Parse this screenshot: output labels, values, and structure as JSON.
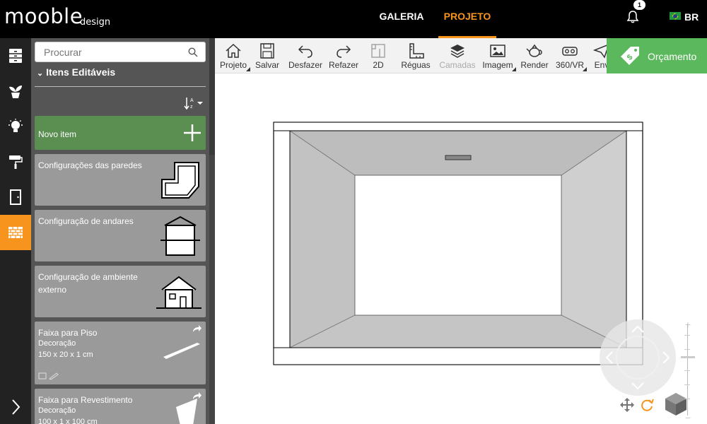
{
  "brand": {
    "name": "mooble",
    "sub": "design"
  },
  "nav": {
    "tabs": [
      "GALERIA",
      "PROJETO"
    ],
    "active": "PROJETO"
  },
  "notifications": {
    "count": "1"
  },
  "language": {
    "code": "BR"
  },
  "colors": {
    "accent": "#f7941d",
    "green": "#5a8f51",
    "orcamento": "#5cb85c"
  },
  "rail": {
    "items": [
      "furniture-icon",
      "plant-icon",
      "lamp-icon",
      "paint-roller-icon",
      "door-icon",
      "wall-brick-icon"
    ],
    "active": "wall-brick-icon"
  },
  "panel": {
    "search_placeholder": "Procurar",
    "section_title": "Itens Editáveis",
    "new_item": "Novo item",
    "cards": [
      {
        "title": "Configurações das paredes",
        "icon": "walls-config-icon"
      },
      {
        "title": "Configuração de andares",
        "icon": "floors-config-icon"
      },
      {
        "title": "Configuração de ambiente externo",
        "icon": "house-icon"
      },
      {
        "title": "Faixa para Piso",
        "category": "Decoração",
        "size": "150 x 20 x 1 cm"
      },
      {
        "title": "Faixa para Revestimento",
        "category": "Decoração",
        "size": "100 x 1 x 100 cm"
      }
    ]
  },
  "toolbar": {
    "tools": [
      {
        "label": "Projeto",
        "icon": "home-icon",
        "submenu": true,
        "disabled": false
      },
      {
        "label": "Salvar",
        "icon": "save-icon",
        "submenu": false,
        "disabled": false
      },
      {
        "label": "Desfazer",
        "icon": "undo-icon",
        "submenu": false,
        "disabled": false
      },
      {
        "label": "Refazer",
        "icon": "redo-icon",
        "submenu": false,
        "disabled": false
      },
      {
        "label": "2D",
        "icon": "2d-icon",
        "submenu": false,
        "disabled": false
      },
      {
        "label": "Réguas",
        "icon": "ruler-icon",
        "submenu": false,
        "disabled": false
      },
      {
        "label": "Camadas",
        "icon": "layers-icon",
        "submenu": false,
        "disabled": true
      },
      {
        "label": "Imagem",
        "icon": "image-icon",
        "submenu": true,
        "disabled": false
      },
      {
        "label": "Render",
        "icon": "teapot-icon",
        "submenu": false,
        "disabled": false
      },
      {
        "label": "360/VR",
        "icon": "vr-icon",
        "submenu": true,
        "disabled": false
      },
      {
        "label": "Env",
        "icon": "send-icon",
        "submenu": false,
        "disabled": false
      }
    ],
    "orcamento_label": "Orçamento"
  }
}
